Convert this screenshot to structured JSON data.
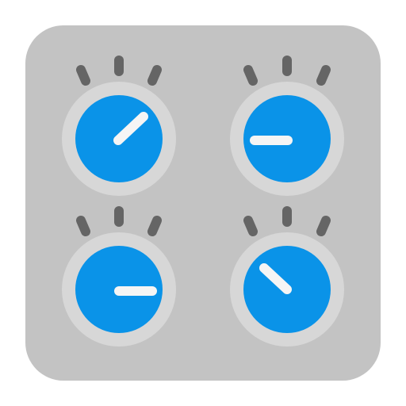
{
  "icon": {
    "name": "control-knobs-icon",
    "colors": {
      "panel": "#c3c3c3",
      "knob_ring": "#d7d7d7",
      "knob_face": "#0a93e8",
      "pointer": "#f5f5f5",
      "tick": "#656565"
    },
    "knobs": [
      {
        "name": "knob-top-left",
        "pointer_direction": "up-right"
      },
      {
        "name": "knob-top-right",
        "pointer_direction": "left"
      },
      {
        "name": "knob-bottom-left",
        "pointer_direction": "right"
      },
      {
        "name": "knob-bottom-right",
        "pointer_direction": "up-left"
      }
    ]
  }
}
